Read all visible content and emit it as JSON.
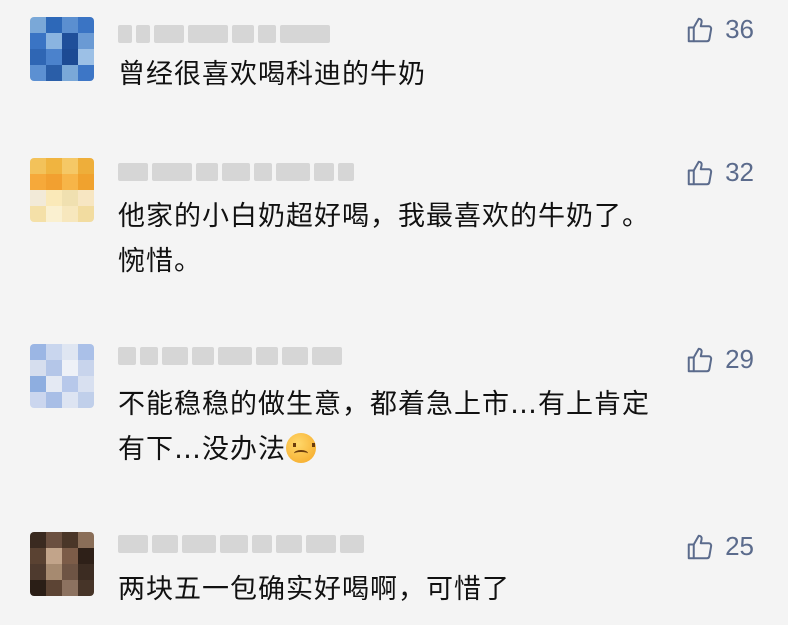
{
  "comments": [
    {
      "likes": "36",
      "text_lines": [
        "曾经很喜欢喝科迪的牛奶"
      ],
      "avatar_colors": [
        "#7aa8d8",
        "#2d68b8",
        "#5b8fd0",
        "#3a74c4",
        "#3a74c4",
        "#8ab4e0",
        "#1f4f9a",
        "#6a9ad4",
        "#2f66b4",
        "#4b82cc",
        "#1c4a94",
        "#9cc0e6",
        "#5c90d2",
        "#2a5ea8",
        "#7aa8d8",
        "#3d76c6"
      ]
    },
    {
      "likes": "32",
      "text_lines": [
        "他家的小白奶超好喝，我最喜欢的牛奶了。",
        "惋惜。"
      ],
      "avatar_colors": [
        "#f3c25a",
        "#f0b440",
        "#f5c866",
        "#eeae3a",
        "#f6a93a",
        "#f2a030",
        "#f7b548",
        "#f0a22e",
        "#f2ead8",
        "#fae9b8",
        "#f0e0b0",
        "#f7e6c2",
        "#f4e0a8",
        "#faf0d0",
        "#f7e7bd",
        "#f2dca0"
      ]
    },
    {
      "likes": "29",
      "text_lines": [
        "不能稳稳的做生意，都着急上市…有上肯定",
        "有下…没办法"
      ],
      "avatar_colors": [
        "#9bb6e4",
        "#c9d6ee",
        "#dfe6f2",
        "#aac0e8",
        "#d6deee",
        "#b4c6e8",
        "#eef1f7",
        "#c8d4ec",
        "#8eaee0",
        "#e4e9f3",
        "#b7c8ea",
        "#d8e0f0",
        "#cbd6ee",
        "#a8bee6",
        "#dde4f2",
        "#c0cfea"
      ]
    },
    {
      "likes": "25",
      "text_lines": [
        "两块五一包确实好喝啊，可惜了"
      ],
      "avatar_colors": [
        "#3a2a20",
        "#6b5040",
        "#4a3628",
        "#8a6e58",
        "#5a4232",
        "#c2a48a",
        "#7c5c48",
        "#2e2018",
        "#4e3a2e",
        "#a68a70",
        "#6e5444",
        "#3c2c22",
        "#2a1e16",
        "#5c4434",
        "#8c7260",
        "#463428"
      ]
    }
  ]
}
